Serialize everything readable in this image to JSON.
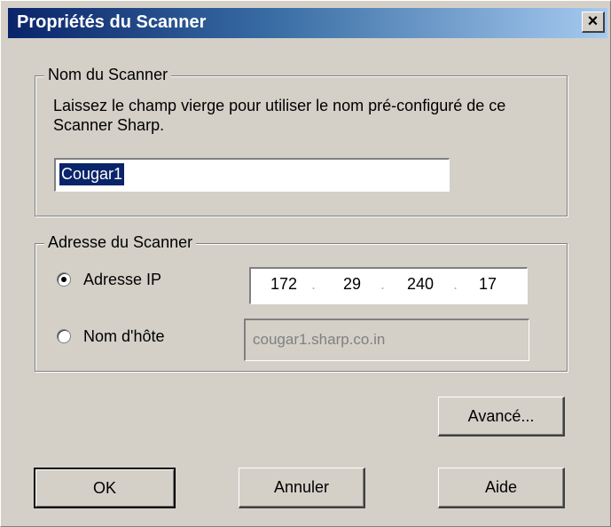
{
  "window": {
    "title": "Propriétés du Scanner",
    "close_glyph": "×"
  },
  "scanner_name": {
    "group_label": "Nom du Scanner",
    "help_text": "Laissez le champ vierge pour utiliser le nom pré-configuré de ce Scanner Sharp.",
    "value": "Cougar1"
  },
  "scanner_address": {
    "group_label": "Adresse du Scanner",
    "ip_option_label": "Adresse IP",
    "ip_selected": true,
    "ip": {
      "seg1": "172",
      "seg2": "29",
      "seg3": "240",
      "seg4": "17",
      "separator": "."
    },
    "hostname_option_label": "Nom d'hôte",
    "hostname_value": "cougar1.sharp.co.in"
  },
  "buttons": {
    "advanced": "Avancé...",
    "ok": "OK",
    "cancel": "Annuler",
    "help": "Aide"
  }
}
